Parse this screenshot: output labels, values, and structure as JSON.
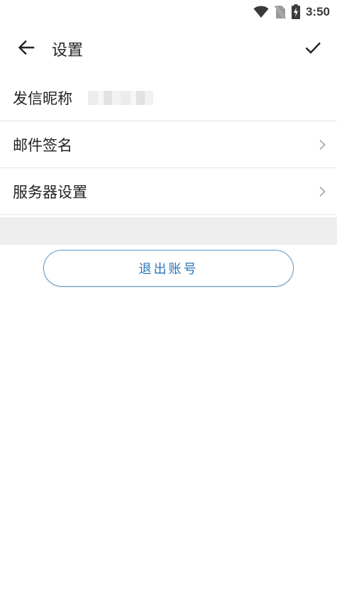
{
  "status_bar": {
    "time": "3:50",
    "icons": [
      "wifi-icon",
      "no-sim-icon",
      "battery-charging-icon"
    ]
  },
  "toolbar": {
    "title": "设置",
    "back_icon": "arrow-left-icon",
    "confirm_icon": "checkmark-icon"
  },
  "settings": {
    "items": [
      {
        "label": "发信昵称",
        "value": ""
      },
      {
        "label": "邮件签名"
      },
      {
        "label": "服务器设置"
      }
    ]
  },
  "logout": {
    "label": "退出账号"
  },
  "colors": {
    "accent": "#2a74b8",
    "border_accent": "#5a9bd0",
    "divider": "#e6e6e6",
    "section_bg": "#eeeeee"
  }
}
